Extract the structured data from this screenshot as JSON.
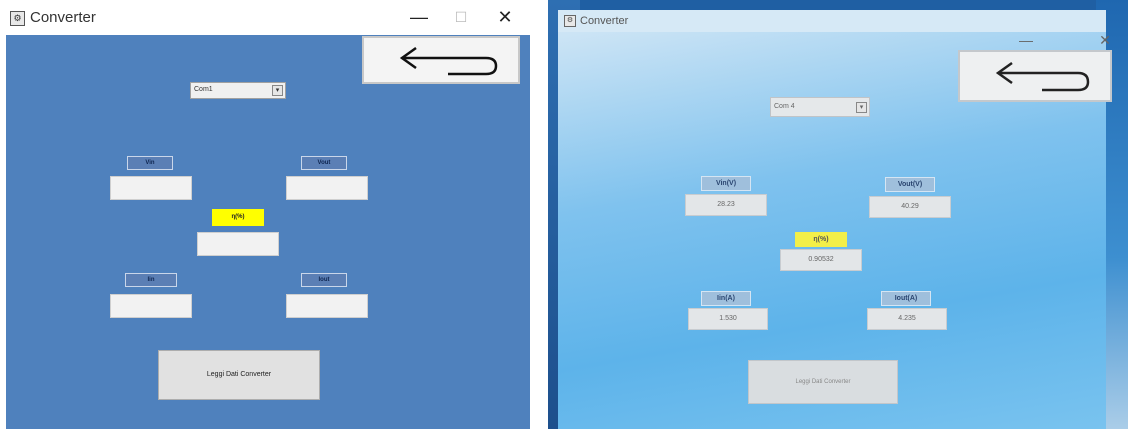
{
  "left": {
    "window": {
      "title": "Converter",
      "icon": "app-icon"
    },
    "window_controls": {
      "minimize": "—",
      "maximize": "☐",
      "close": "✕"
    },
    "back_button": {
      "icon": "back-arrow-icon"
    },
    "port_combo": {
      "value": "Com1",
      "arrow": "▾"
    },
    "fields": {
      "vin": {
        "label": "Vin",
        "value": ""
      },
      "vout": {
        "label": "Vout",
        "value": ""
      },
      "eta": {
        "label": "η(%)",
        "value": ""
      },
      "iin": {
        "label": "Iin",
        "value": ""
      },
      "iout": {
        "label": "Iout",
        "value": ""
      }
    },
    "read_button": {
      "label": "Leggi Dati Converter"
    }
  },
  "right": {
    "window": {
      "title": "Converter",
      "icon": "app-icon"
    },
    "window_controls": {
      "minimize": "—",
      "close": "✕"
    },
    "back_button": {
      "icon": "back-arrow-icon"
    },
    "port_combo": {
      "value": "Com 4",
      "arrow": "▾"
    },
    "fields": {
      "vin": {
        "label": "Vin(V)",
        "value": "28.23"
      },
      "vout": {
        "label": "Vout(V)",
        "value": "40.29"
      },
      "eta": {
        "label": "η(%)",
        "value": "0.90532"
      },
      "iin": {
        "label": "Iin(A)",
        "value": "1.530"
      },
      "iout": {
        "label": "Iout(A)",
        "value": "4.235"
      }
    },
    "read_button": {
      "label": "Leggi Dati Converter"
    }
  },
  "colors": {
    "client_blue": "#4f81bd",
    "label_highlight": "#ffff00",
    "field_bg": "#f2f2f2"
  }
}
